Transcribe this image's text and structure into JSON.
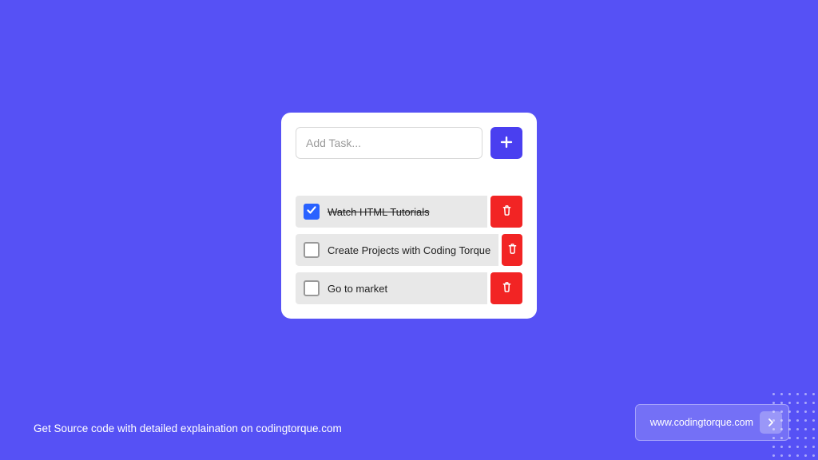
{
  "input": {
    "placeholder": "Add Task..."
  },
  "tasks": [
    {
      "label": "Watch HTML Tutorials",
      "done": true
    },
    {
      "label": "Create Projects with Coding Torque",
      "done": false
    },
    {
      "label": "Go to market",
      "done": false
    }
  ],
  "footer": {
    "tagline": "Get Source code with detailed explaination on codingtorque.com",
    "site": "www.codingtorque.com"
  }
}
